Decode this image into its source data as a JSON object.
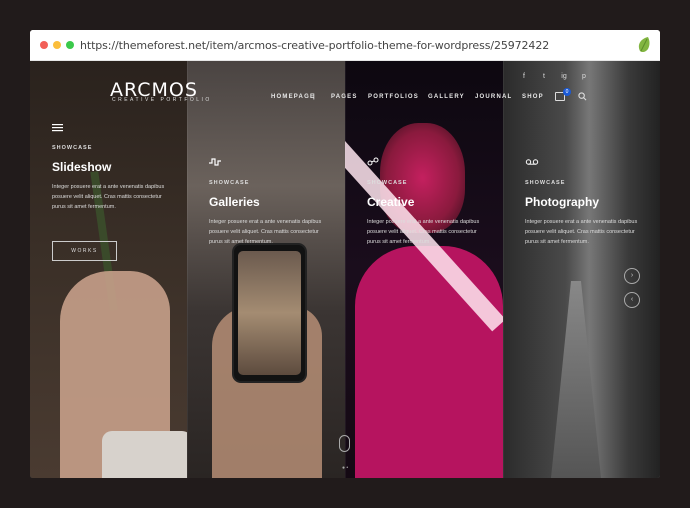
{
  "browser": {
    "url": "https://themeforest.net/item/arcmos-creative-portfolio-theme-for-wordpress/25972422",
    "icon": "envato-leaf-icon"
  },
  "site": {
    "logo": "ARCMOS",
    "logo_sub": "CREATIVE PORTFOLIO",
    "nav": [
      "HOMEPAGE",
      "PAGES",
      "PORTFOLIOS",
      "GALLERY",
      "JOURNAL",
      "SHOP"
    ],
    "nav_separator": "|",
    "social": [
      "f",
      "t",
      "ig",
      "p"
    ],
    "cart_count": "0",
    "panels": [
      {
        "icon": "menu-lines-icon",
        "kicker": "SHOWCASE",
        "title": "Slideshow",
        "desc": "Integer posuere erat a ante venenatis dapibus posuere velit aliquet. Cras mattis consectetur purus sit amet fermentum.",
        "button": "WORKS"
      },
      {
        "icon": "wave-icon",
        "kicker": "SHOWCASE",
        "title": "Galleries",
        "desc": "Integer posuere erat a ante venenatis dapibus posuere velit aliquet. Cras mattis consectetur purus sit amet fermentum."
      },
      {
        "icon": "nodes-icon",
        "kicker": "SHOWCASE",
        "title": "Creative",
        "desc": "Integer posuere erat a ante venenatis dapibus posuere velit aliquet. Cras mattis consectetur purus sit amet fermentum."
      },
      {
        "icon": "tape-icon",
        "kicker": "SHOWCASE",
        "title": "Photography",
        "desc": "Integer posuere erat a ante venenatis dapibus posuere velit aliquet. Cras mattis consectetur purus sit amet fermentum."
      }
    ],
    "pager": "● •"
  }
}
